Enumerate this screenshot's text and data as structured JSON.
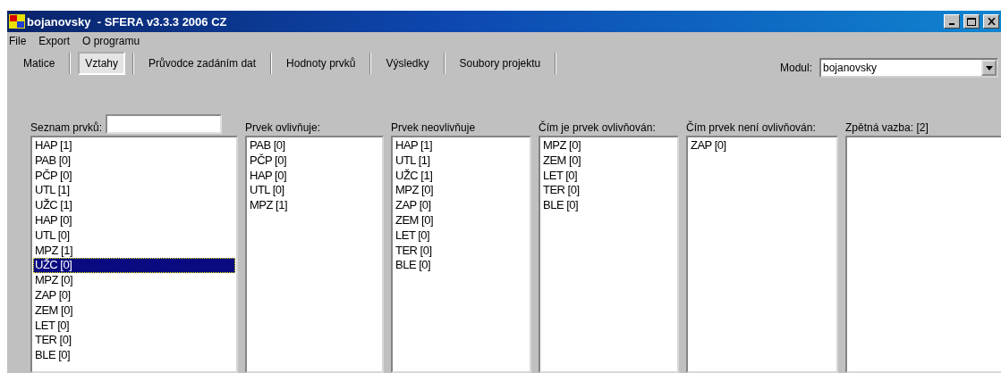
{
  "window": {
    "title": "bojanovsky  - SFERA v3.3.3 2006 CZ"
  },
  "menu": [
    "File",
    "Export",
    "O programu"
  ],
  "tabs": [
    {
      "label": "Matice",
      "selected": false
    },
    {
      "label": "Vztahy",
      "selected": true
    },
    {
      "label": "Průvodce zadáním dat",
      "selected": false
    },
    {
      "label": "Hodnoty prvků",
      "selected": false
    },
    {
      "label": "Výsledky",
      "selected": false
    },
    {
      "label": "Soubory projektu",
      "selected": false
    }
  ],
  "module": {
    "label": "Modul:",
    "value": "bojanovsky"
  },
  "lists": [
    {
      "label": "Seznam prvků:",
      "kind": "filtered",
      "items": [
        {
          "text": "HAP [1]",
          "selected": false
        },
        {
          "text": "PAB [0]",
          "selected": false
        },
        {
          "text": "PČP [0]",
          "selected": false
        },
        {
          "text": "UTL [1]",
          "selected": false
        },
        {
          "text": "UŽC [1]",
          "selected": false
        },
        {
          "text": "HAP [0]",
          "selected": false
        },
        {
          "text": "UTL [0]",
          "selected": false
        },
        {
          "text": "MPZ [1]",
          "selected": false
        },
        {
          "text": "UŽC [0]",
          "selected": true
        },
        {
          "text": "MPZ [0]",
          "selected": false
        },
        {
          "text": "ZAP [0]",
          "selected": false
        },
        {
          "text": "ZEM [0]",
          "selected": false
        },
        {
          "text": "LET [0]",
          "selected": false
        },
        {
          "text": "TER [0]",
          "selected": false
        },
        {
          "text": "BLE [0]",
          "selected": false
        }
      ]
    },
    {
      "label": "Prvek ovlivňuje:",
      "kind": "plain",
      "items": [
        {
          "text": "PAB [0]",
          "selected": false
        },
        {
          "text": "PČP [0]",
          "selected": false
        },
        {
          "text": "HAP [0]",
          "selected": false
        },
        {
          "text": "UTL [0]",
          "selected": false
        },
        {
          "text": "MPZ [1]",
          "selected": false
        }
      ]
    },
    {
      "label": "Prvek neovlivňuje",
      "kind": "plain",
      "items": [
        {
          "text": "HAP [1]",
          "selected": false
        },
        {
          "text": "UTL [1]",
          "selected": false
        },
        {
          "text": "UŽC [1]",
          "selected": false
        },
        {
          "text": "MPZ [0]",
          "selected": false
        },
        {
          "text": "ZAP [0]",
          "selected": false
        },
        {
          "text": "ZEM [0]",
          "selected": false
        },
        {
          "text": "LET [0]",
          "selected": false
        },
        {
          "text": "TER [0]",
          "selected": false
        },
        {
          "text": "BLE [0]",
          "selected": false
        }
      ]
    },
    {
      "label": "Čím je prvek ovlivňován:",
      "kind": "plain",
      "items": [
        {
          "text": "MPZ [0]",
          "selected": false
        },
        {
          "text": "ZEM [0]",
          "selected": false
        },
        {
          "text": "LET [0]",
          "selected": false
        },
        {
          "text": "TER [0]",
          "selected": false
        },
        {
          "text": "BLE [0]",
          "selected": false
        }
      ]
    },
    {
      "label": "Čím prvek není ovlivňován:",
      "kind": "plain",
      "items": [
        {
          "text": "ZAP [0]",
          "selected": false
        }
      ]
    },
    {
      "label": "Zpětná vazba: [2]",
      "kind": "plain"
    }
  ]
}
